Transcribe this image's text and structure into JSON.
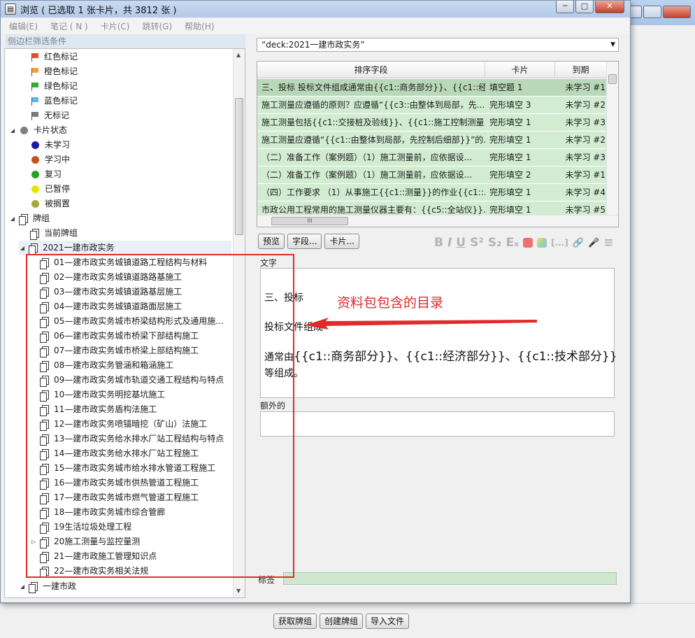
{
  "window": {
    "title": "浏览 ( 已选取 1 张卡片，共 3812 张 )",
    "minimize": "─",
    "maximize": "□",
    "close": "✕"
  },
  "menu": [
    "编辑(E)",
    "笔记 ( N )",
    "卡片(C)",
    "跳转(G)",
    "帮助(H)"
  ],
  "sidebar": {
    "title": "侧边栏筛选条件",
    "flags": [
      {
        "label": "红色标记",
        "color": "#e0542a"
      },
      {
        "label": "橙色标记",
        "color": "#f4a234"
      },
      {
        "label": "绿色标记",
        "color": "#28b428"
      },
      {
        "label": "蓝色标记",
        "color": "#5db7ec"
      },
      {
        "label": "无标记",
        "color": "#7a7a7a"
      }
    ],
    "card_state": {
      "label": "卡片状态",
      "items": [
        {
          "label": "未学习",
          "color": "#1a1aa8"
        },
        {
          "label": "学习中",
          "color": "#c0521c"
        },
        {
          "label": "复习",
          "color": "#22a22a"
        },
        {
          "label": "已暂停",
          "color": "#e6e600"
        },
        {
          "label": "被搁置",
          "color": "#a8a83a"
        }
      ]
    },
    "decks_label": "牌组",
    "current_deck": "当前牌组",
    "deck_2021": "2021一建市政实务",
    "subdecks": [
      "01—建市政实务城镇道路工程结构与材料",
      "02—建市政实务城镇道路路基施工",
      "03—建市政实务城镇道路基层施工",
      "04—建市政实务城镇道路面层施工",
      "05—建市政实务城市桥梁结构形式及通用施...",
      "06—建市政实务城市桥梁下部结构施工",
      "07—建市政实务城市桥梁上部结构施工",
      "08—建市政实务管涵和箱涵施工",
      "09—建市政实务城市轨道交通工程结构与特点",
      "10—建市政实务明挖基坑施工",
      "11—建市政实务盾构法施工",
      "12—建市政实务喷锚暗挖（矿山）法施工",
      "13—建市政实务给水排水厂站工程结构与特点",
      "14—建市政实务给水排水厂站工程施工",
      "15—建市政实务城市给水排水管道工程施工",
      "16—建市政实务城市供热管道工程施工",
      "17—建市政实务城市燃气管道工程施工",
      "18—建市政实务城市综合管廊",
      "19生活垃圾处理工程",
      "20施工测量与监控量测",
      "21—建市政施工管理知识点",
      "22—建市政实务相关法规"
    ],
    "last_deck": "一建市政"
  },
  "search": {
    "value": "“deck:2021一建市政实务”"
  },
  "table": {
    "columns": [
      "排序字段",
      "卡片",
      "到期"
    ],
    "rows": [
      {
        "field": "三、投标 投标文件组成通常由{{c1::商务部分}}、{{c1::经...",
        "card": "填空题 1",
        "due": "未学习 #1"
      },
      {
        "field": "施工测量应遵循的原则？应遵循“{{c3::由整体到局部，先...",
        "card": "完形填空 3",
        "due": "未学习 #2"
      },
      {
        "field": "施工测量包括{{c1::交接桩及验线}}、{{c1::施工控制测量}}...",
        "card": "完形填空 1",
        "due": "未学习 #3"
      },
      {
        "field": "施工测量应遵循“{{c1::由整体到局部，先控制后细部}}”的...",
        "card": "完形填空 1",
        "due": "未学习 #2"
      },
      {
        "field": "（二）准备工作（案例题）（1）施工测量前，应依据设...",
        "card": "完形填空 1",
        "due": "未学习 #3"
      },
      {
        "field": "（二）准备工作（案例题）（1）施工测量前，应依据设...",
        "card": "完形填空 2",
        "due": "未学习 #1"
      },
      {
        "field": "（四）工作要求 （1）从事施工{{c1::测量}}的作业{{c1::...",
        "card": "完形填空 1",
        "due": "未学习 #4"
      },
      {
        "field": "市政公用工程常用的施工测量仪器主要有：{{c5::全站仪}}...",
        "card": "完形填空 1",
        "due": "未学习 #5"
      }
    ],
    "scroll_mark": "III"
  },
  "buttons": {
    "preview": "预览",
    "fields": "字段...",
    "cards": "卡片..."
  },
  "toolbar_glyphs": {
    "bold": "B",
    "italic": "I",
    "underline": "U",
    "sup": "S²",
    "sub": "S₂",
    "clear": "Eₓ",
    "cloze": "[...]",
    "attach": "🔗",
    "record": "🎤",
    "more": "≡"
  },
  "toolbar_colors": {
    "red": "#f07070",
    "multi": "#9fd39f"
  },
  "editor": {
    "field1_label": "文字",
    "line1": "三、投标",
    "line2": "投标文件组成",
    "line3_prefix": "通常由",
    "line3_cloze": "{{c1::商务部分}}、{{c1::经济部分}}、{{c1::技术部分}}",
    "line4": "等组成。",
    "field2_label": "额外的",
    "tags_label": "标签"
  },
  "bottom_buttons": [
    "获取牌组",
    "创建牌组",
    "导入文件"
  ],
  "annotation": {
    "text": "资料包包含的目录",
    "color": "#e12a2a"
  }
}
